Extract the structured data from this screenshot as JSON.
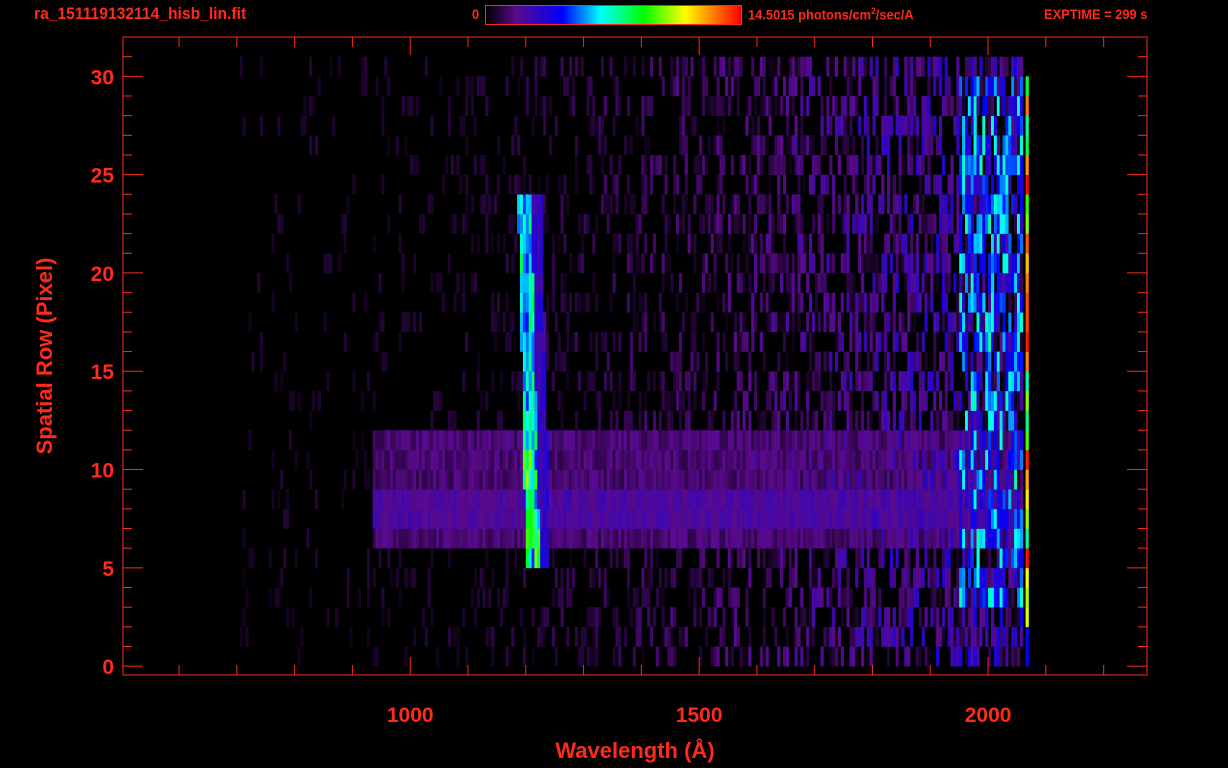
{
  "chart_data": {
    "type": "heatmap",
    "title": "ra_151119132114_hisb_lin.fit",
    "xlabel": "Wavelength (Å)",
    "ylabel": "Spatial Row (Pixel)",
    "xlim": [
      503,
      2275
    ],
    "ylim": [
      -0.45,
      32
    ],
    "xticks": [
      1000,
      1500,
      2000
    ],
    "xtick_labels": [
      "1000",
      "1500",
      "2000"
    ],
    "x_minor_step": 100,
    "yticks": [
      0,
      5,
      10,
      15,
      20,
      25,
      30
    ],
    "ytick_labels": [
      "0",
      "5",
      "10",
      "15",
      "20",
      "25",
      "30"
    ],
    "y_minor_step": 1,
    "colorbar": {
      "min_label": "0",
      "max_label": "14.5015 photons/cm",
      "unit_sup": "2",
      "unit_tail": "/sec/A",
      "min": 0,
      "max": 14.5015,
      "colormap": "rainbow"
    },
    "exptime": "EXPTIME = 299 s",
    "features": [
      {
        "name": "emission line",
        "wavelength": 1210,
        "rows": [
          5,
          24
        ],
        "intensity": 0.45
      },
      {
        "name": "diffuse band",
        "wavelength_range": [
          930,
          2050
        ],
        "rows": [
          6,
          12
        ],
        "intensity": 0.1
      },
      {
        "name": "noise region",
        "wavelength_range": [
          700,
          2060
        ],
        "rows": [
          0,
          30
        ],
        "intensity": 0.05
      },
      {
        "name": "detector edge",
        "wavelength": 2064,
        "rows": [
          0,
          30
        ],
        "intensity": 0.8
      }
    ]
  },
  "colors": {
    "axis": "#ff2a1a",
    "background": "#000000"
  }
}
